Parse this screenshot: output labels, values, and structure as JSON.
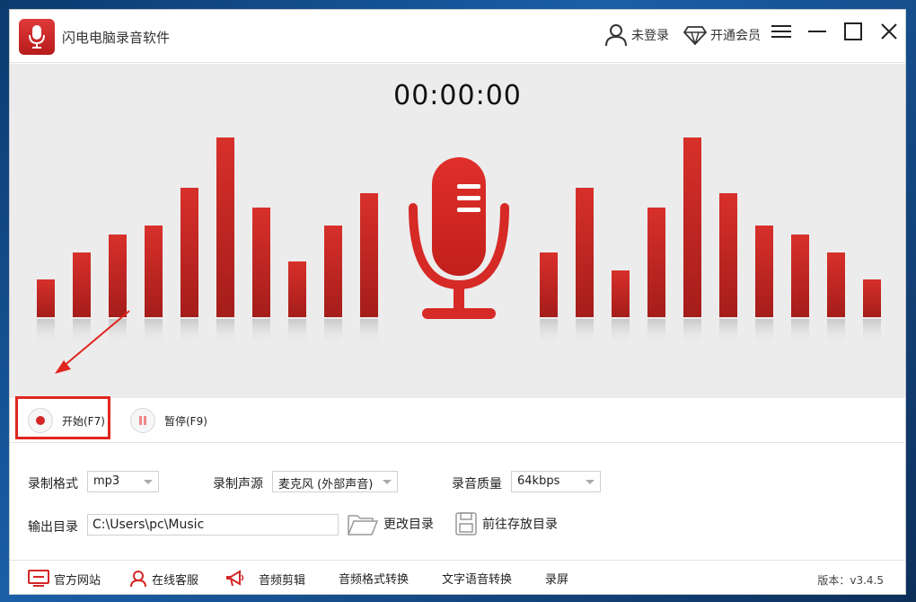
{
  "app": {
    "title": "闪电电脑录音软件"
  },
  "titlebar": {
    "login_label": "未登录",
    "vip_label": "开通会员"
  },
  "timer": {
    "value": "00:00:00"
  },
  "controls": {
    "start_label": "开始(F7)",
    "pause_label": "暂停(F9)"
  },
  "settings": {
    "format_label": "录制格式",
    "format_value": "mp3",
    "source_label": "录制声源",
    "source_value": "麦克风 (外部声音)",
    "quality_label": "录音质量",
    "quality_value": "64kbps",
    "output_label": "输出目录",
    "output_value": "C:\\Users\\pc\\Music",
    "change_dir_label": "更改目录",
    "open_dir_label": "前往存放目录"
  },
  "footer": {
    "website": "官方网站",
    "support": "在线客服",
    "audio_edit": "音频剪辑",
    "format_convert": "音频格式转换",
    "tts": "文字语音转换",
    "screen_record": "录屏",
    "version": "版本：v3.4.5"
  },
  "colors": {
    "accent": "#d32626",
    "bar_top": "#d8302b",
    "bar_bottom": "#a51d1a"
  },
  "visualizer": {
    "left_levels": [
      0.21,
      0.36,
      0.46,
      0.51,
      0.72,
      1.0,
      0.61,
      0.31,
      0.51,
      0.69
    ],
    "right_levels": [
      0.36,
      0.72,
      0.26,
      0.61,
      1.0,
      0.69,
      0.51,
      0.46,
      0.36,
      0.21
    ]
  }
}
